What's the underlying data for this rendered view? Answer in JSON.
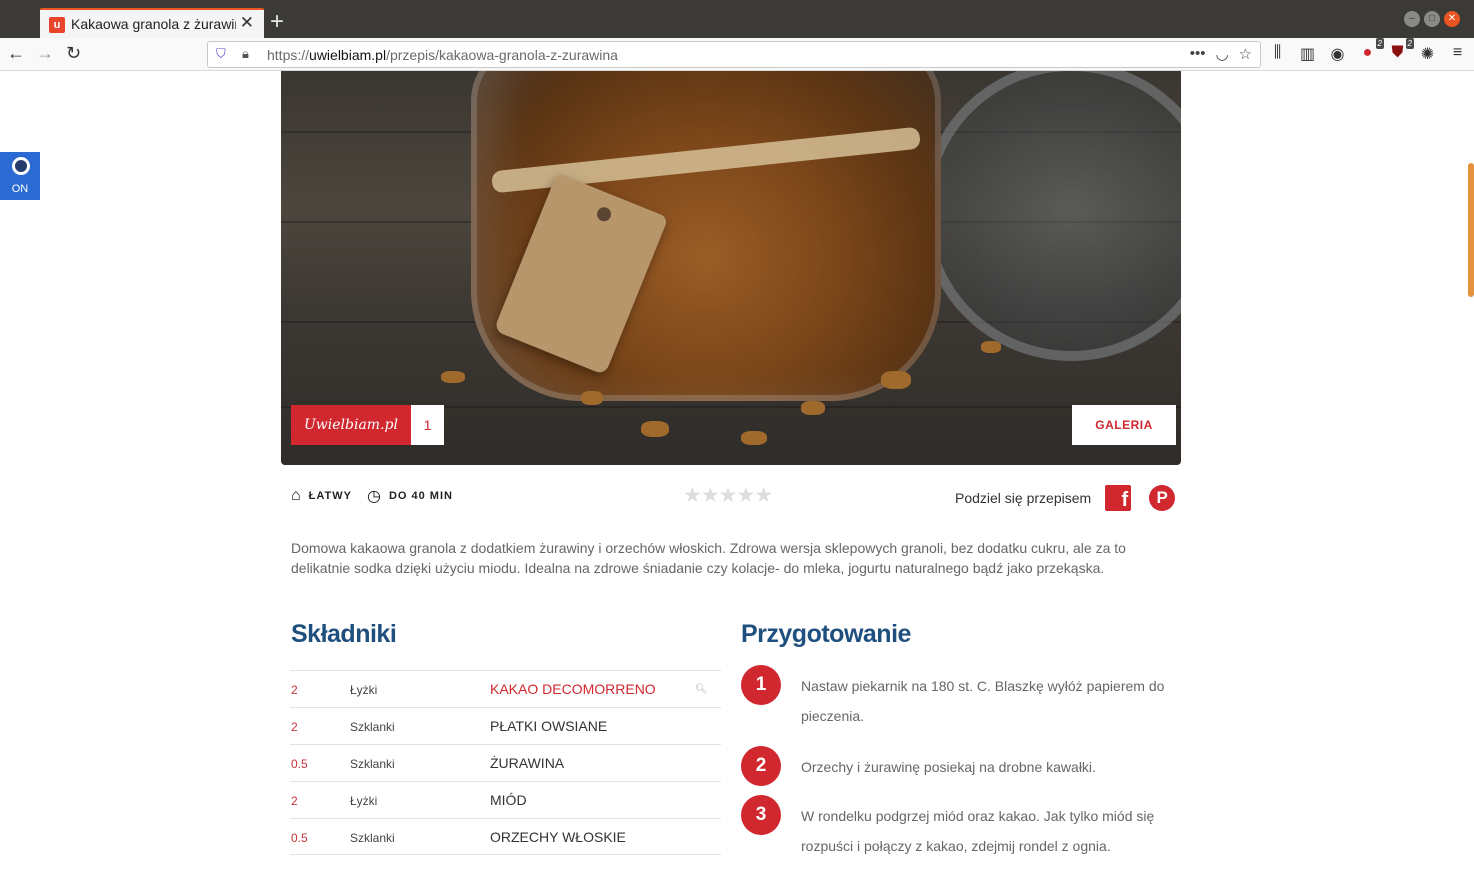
{
  "browser": {
    "tab_title": "Kakaowa granola z żurawiną",
    "tab_favicon": "u",
    "url_host": "uwielbiam.pl",
    "url_prefix": "https://",
    "url_path": "/przepis/kakaowa-granola-z-zurawina",
    "badges": [
      "2",
      "2"
    ]
  },
  "toggle": {
    "label": "ON"
  },
  "hero": {
    "logo_text": "Uwielbiam.pl",
    "count": "1",
    "gallery_label": "GALERIA"
  },
  "meta": {
    "difficulty": "ŁATWY",
    "time": "DO 40 MIN",
    "stars": "★★★★★",
    "share_label": "Podziel się przepisem"
  },
  "description": "Domowa kakaowa granola z dodatkiem żurawiny i orzechów włoskich. Zdrowa wersja sklepowych granoli, bez dodatku cukru, ale za to delikatnie sodka dzięki użyciu miodu. Idealna na zdrowe śniadanie czy kolacje- do mleka, jogurtu naturalnego bądź jako przekąska.",
  "ingredients": {
    "title": "Składniki",
    "items": [
      {
        "qty": "2",
        "unit": "Łyżki",
        "name": "KAKAO DECOMORRENO"
      },
      {
        "qty": "2",
        "unit": "Szklanki",
        "name": "PŁATKI OWSIANE"
      },
      {
        "qty": "0.5",
        "unit": "Szklanki",
        "name": "ŻURAWINA"
      },
      {
        "qty": "2",
        "unit": "Łyżki",
        "name": "MIÓD"
      },
      {
        "qty": "0.5",
        "unit": "Szklanki",
        "name": "ORZECHY WŁOSKIE"
      }
    ]
  },
  "preparation": {
    "title": "Przygotowanie",
    "steps": [
      {
        "num": "1",
        "text": "Nastaw piekarnik na 180 st. C. Blaszkę wyłóż papierem do pieczenia."
      },
      {
        "num": "2",
        "text": "Orzechy i żurawinę posiekaj na drobne kawałki."
      },
      {
        "num": "3",
        "text": "W rondelku podgrzej miód oraz kakao. Jak tylko miód się rozpuści i połączy z kakao, zdejmij rondel z ognia."
      }
    ]
  },
  "colors": {
    "accent": "#d0282e",
    "heading": "#1f4f7e",
    "tab_accent": "#e95420"
  }
}
